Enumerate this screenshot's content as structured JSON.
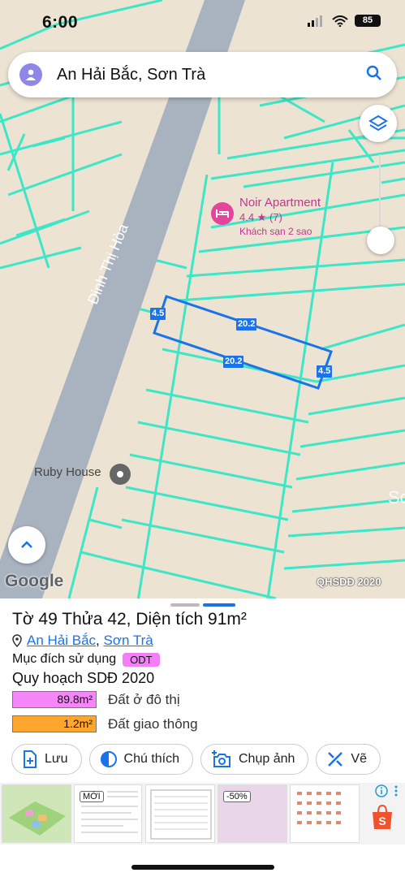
{
  "status_bar": {
    "time": "6:00",
    "battery": "85"
  },
  "search": {
    "query": "An Hải Bắc, Sơn Trà"
  },
  "map": {
    "street_name": "Đinh Thị Hòa",
    "poi_noir": {
      "name": "Noir Apartment",
      "rating": "4.4 ★ (7)",
      "type": "Khách sạn 2 sao"
    },
    "poi_ruby": {
      "name": "Ruby House"
    },
    "dimensions": {
      "top": "20.2",
      "bottom": "20.2",
      "left": "4.5",
      "right": "4.5"
    },
    "logo": "Google",
    "source": "QHSDĐ 2020"
  },
  "sheet": {
    "title": "Tờ 49 Thửa 42, Diện tích 91m²",
    "ward": "An Hải Bắc",
    "sep": ",",
    "district": "Sơn Trà",
    "purpose_label": "Mục đích sử dụng",
    "purpose_code": "ODT",
    "plan_title": "Quy hoạch SDĐ 2020",
    "plan_items": [
      {
        "area": "89.8m²",
        "label": "Đất ở đô thị",
        "color": "#f586f7"
      },
      {
        "area": "1.2m²",
        "label": "Đất giao thông",
        "color": "#ffa630"
      }
    ],
    "actions": {
      "save": "Lưu",
      "legend": "Chú thích",
      "capture": "Chụp ảnh",
      "draw": "Vẽ"
    }
  },
  "ads": {
    "new_tag": "MỚI",
    "discount_tag": "-50%"
  },
  "colors": {
    "accent": "#1a73e8",
    "road": "#a9b3c0",
    "parcel_line": "#3ee6c8",
    "map_bg": "#ece3d3"
  }
}
